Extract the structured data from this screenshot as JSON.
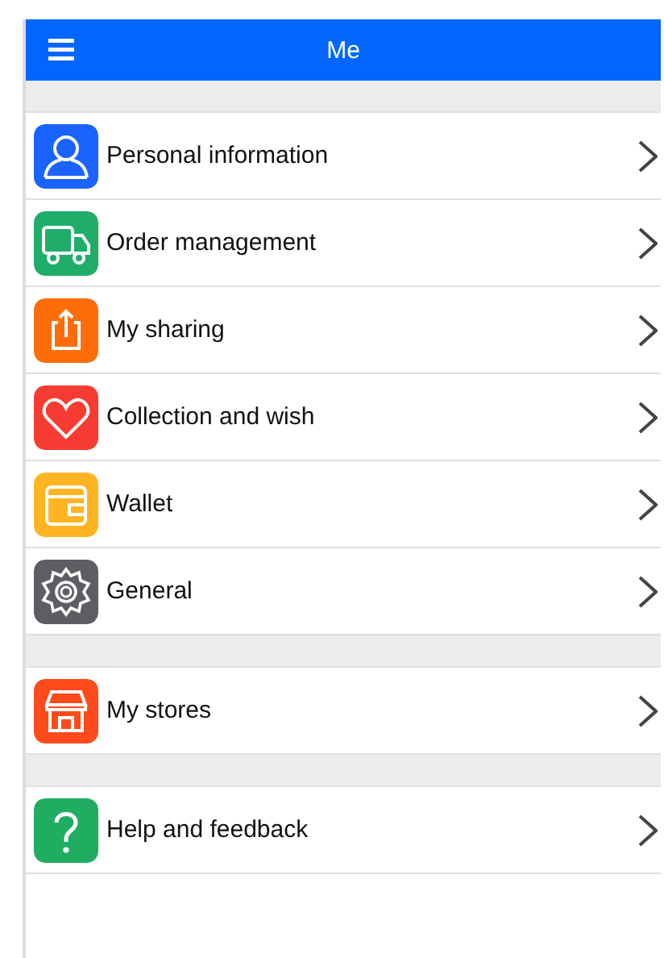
{
  "header": {
    "title": "Me"
  },
  "groups": [
    {
      "items": [
        {
          "label": "Personal information",
          "kind": "person",
          "color": "#1a63ff"
        },
        {
          "label": "Order management",
          "kind": "truck",
          "color": "#1fae6a"
        },
        {
          "label": "My sharing",
          "kind": "share",
          "color": "#ff6d0a"
        },
        {
          "label": "Collection and wish",
          "kind": "heart",
          "color": "#f63c32"
        },
        {
          "label": "Wallet",
          "kind": "wallet",
          "color": "#ffb522"
        },
        {
          "label": "General",
          "kind": "gear",
          "color": "#5d5e62"
        }
      ]
    },
    {
      "items": [
        {
          "label": "My stores",
          "kind": "store",
          "color": "#ff4a1c"
        }
      ]
    },
    {
      "items": [
        {
          "label": "Help and feedback",
          "kind": "help",
          "color": "#20ad62"
        }
      ]
    }
  ]
}
